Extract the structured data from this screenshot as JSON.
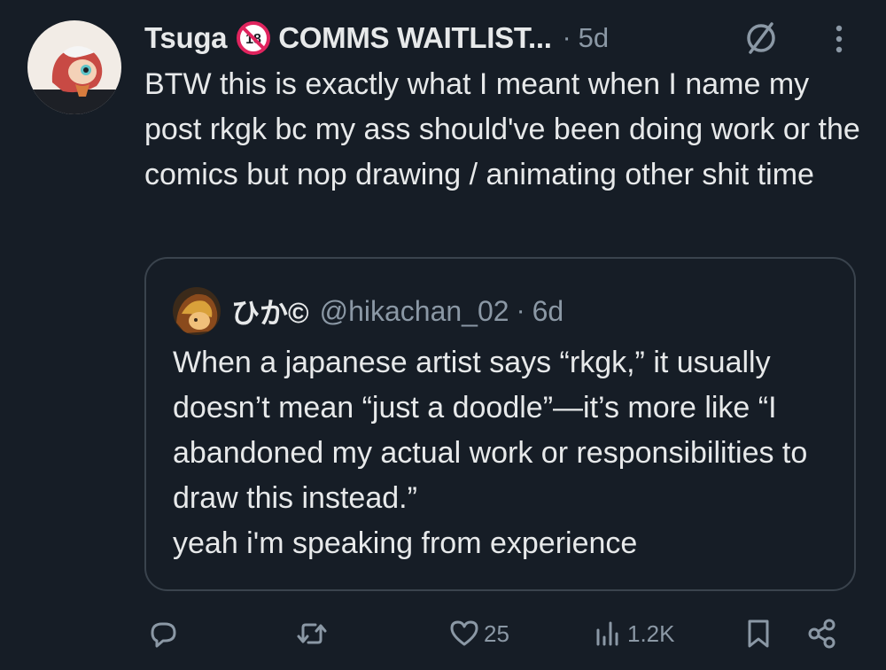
{
  "post": {
    "author_name": "Tsuga",
    "badge": "18",
    "display_suffix": "COMMS WAITLIST...",
    "separator": "·",
    "time_ago": "5d",
    "text": "BTW this is exactly what I meant when I name my post rkgk bc my ass should've been doing work or the comics but nop drawing / animating other shit time"
  },
  "quoted_post": {
    "author_name": "ひか©",
    "handle": "@hikachan_02",
    "separator": "·",
    "time_ago": "6d",
    "text": "When a japanese artist says “rkgk,” it usually doesn’t mean “just a doodle”—it’s more like “I abandoned my actual work or responsibilities to draw this instead.”\nyeah i'm speaking from experience"
  },
  "actions": {
    "reply_icon": "reply-icon",
    "repost_icon": "repost-icon",
    "like_icon": "heart-icon",
    "like_count": "25",
    "views_icon": "views-icon",
    "view_count": "1.2K",
    "bookmark_icon": "bookmark-icon",
    "share_icon": "share-icon"
  },
  "colors": {
    "background": "#161d26",
    "primary_text": "#e7e9ea",
    "secondary_text": "#8b98a5",
    "border": "#3a434d",
    "badge_red": "#e0245e"
  }
}
